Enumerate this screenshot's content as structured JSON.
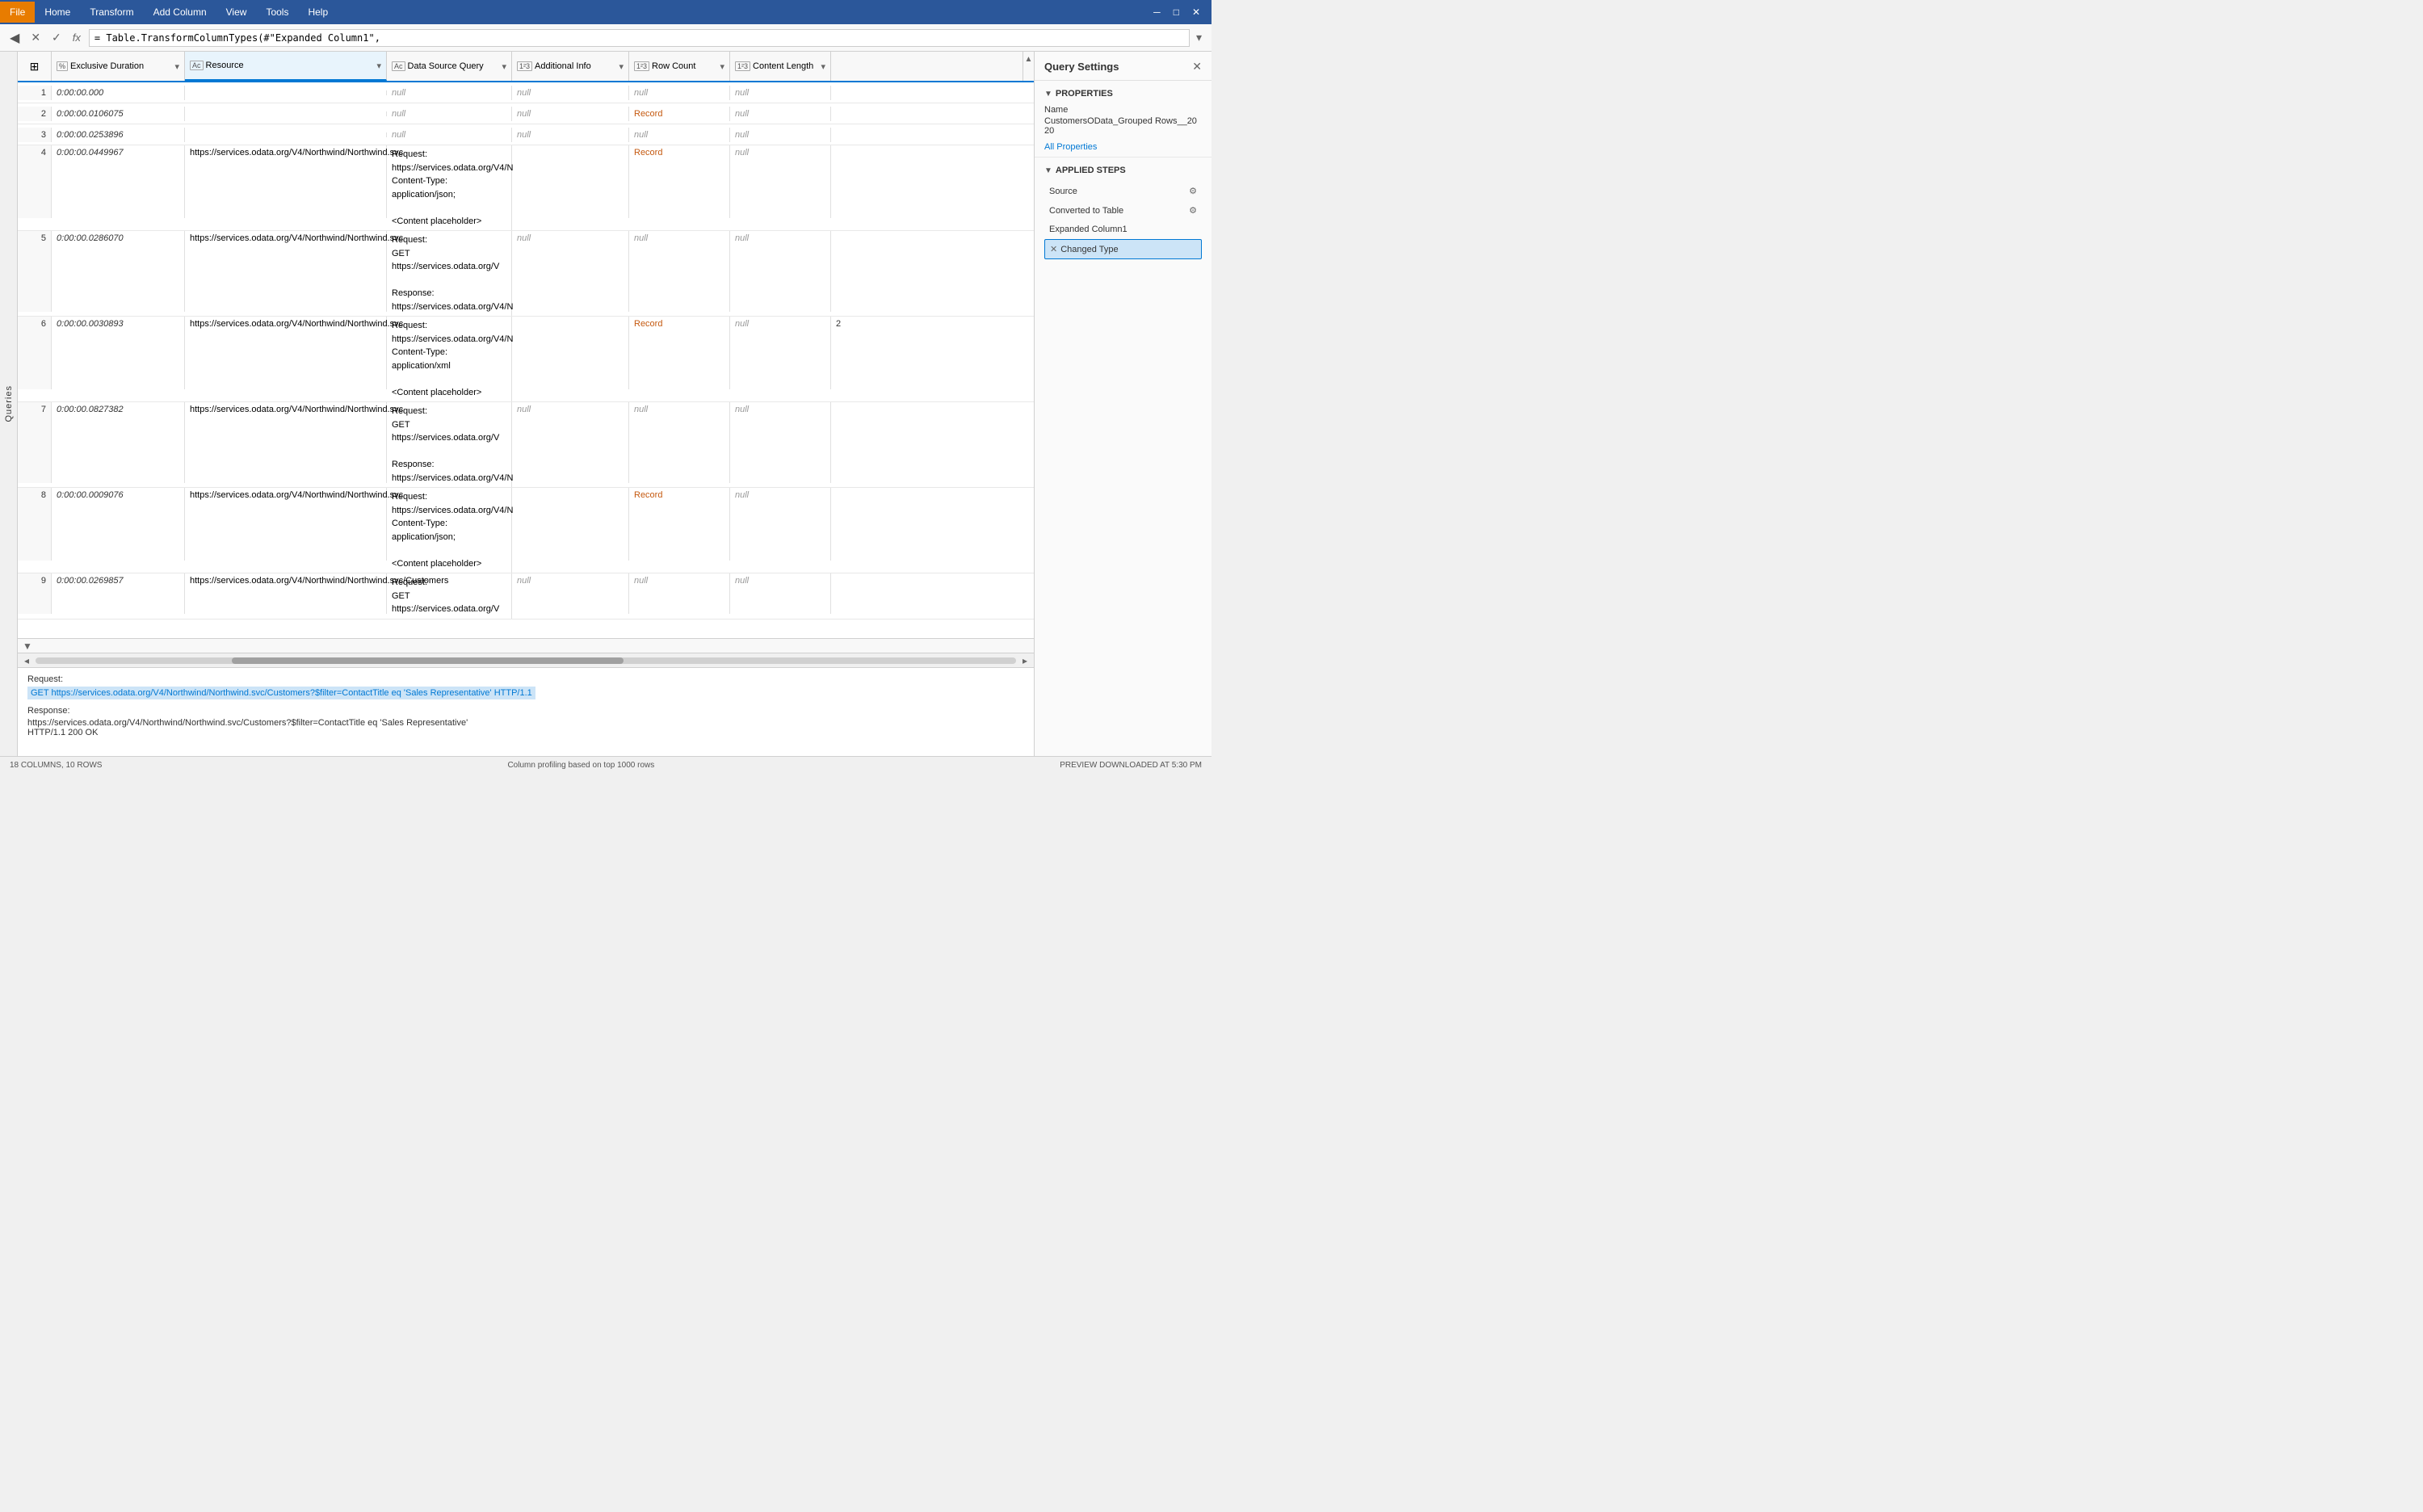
{
  "menubar": {
    "file": "File",
    "home": "Home",
    "transform": "Transform",
    "add_column": "Add Column",
    "view": "View",
    "tools": "Tools",
    "help": "Help"
  },
  "formula_bar": {
    "formula": "= Table.TransformColumnTypes(#\"Expanded Column1\","
  },
  "columns": [
    {
      "id": "row-num",
      "label": "",
      "type": "",
      "icon": ""
    },
    {
      "id": "excl-dur",
      "label": "Exclusive Duration",
      "type": "pct",
      "icon": "%"
    },
    {
      "id": "resource",
      "label": "Resource",
      "type": "text",
      "icon": "Ac"
    },
    {
      "id": "dsq",
      "label": "Data Source Query",
      "type": "text",
      "icon": "Ac"
    },
    {
      "id": "ai",
      "label": "Additional Info",
      "type": "num",
      "icon": "123"
    },
    {
      "id": "rc",
      "label": "Row Count",
      "type": "num",
      "icon": "123"
    },
    {
      "id": "cl",
      "label": "Content Length",
      "type": "num",
      "icon": "123"
    }
  ],
  "rows": [
    {
      "num": "1",
      "excl_dur": "0:00:00.000",
      "resource": "",
      "dsq": "null",
      "ai": "null",
      "rc": "null",
      "cl": "null"
    },
    {
      "num": "2",
      "excl_dur": "0:00:00.0106075",
      "resource": "",
      "dsq": "null",
      "ai": "null",
      "rc": "Record",
      "cl": "null"
    },
    {
      "num": "3",
      "excl_dur": "0:00:00.0253896",
      "resource": "",
      "dsq": "null",
      "ai": "null",
      "rc": "null",
      "cl": "null"
    },
    {
      "num": "4",
      "excl_dur": "0:00:00.0449967",
      "resource": "https://services.odata.org/V4/Northwind/Northwind.svc",
      "dsq": "Request:\nhttps://services.odata.org/V4/N\nContent-Type: application/json;\n\n<Content placeholder>",
      "ai": "",
      "rc": "Record",
      "cl": "null"
    },
    {
      "num": "5",
      "excl_dur": "0:00:00.0286070",
      "resource": "https://services.odata.org/V4/Northwind/Northwind.svc",
      "dsq": "Request:\nGET https://services.odata.org/V\n\nResponse:\nhttps://services.odata.org/V4/N",
      "ai": "null",
      "rc": "null",
      "cl": "null"
    },
    {
      "num": "6",
      "excl_dur": "0:00:00.0030893",
      "resource": "https://services.odata.org/V4/Northwind/Northwind.svc",
      "dsq": "Request:\nhttps://services.odata.org/V4/N\nContent-Type: application/xml\n\n<Content placeholder>",
      "ai": "",
      "rc": "Record",
      "cl": "null",
      "cl2": "2"
    },
    {
      "num": "7",
      "excl_dur": "0:00:00.0827382",
      "resource": "https://services.odata.org/V4/Northwind/Northwind.svc",
      "dsq": "Request:\nGET https://services.odata.org/V\n\nResponse:\nhttps://services.odata.org/V4/N",
      "ai": "null",
      "rc": "null",
      "cl": "null"
    },
    {
      "num": "8",
      "excl_dur": "0:00:00.0009076",
      "resource": "https://services.odata.org/V4/Northwind/Northwind.svc",
      "dsq": "Request:\nhttps://services.odata.org/V4/N\nContent-Type: application/json;\n\n<Content placeholder>",
      "ai": "",
      "rc": "Record",
      "cl": "null",
      "cl2": "."
    },
    {
      "num": "9",
      "excl_dur": "0:00:00.0269857",
      "resource": "https://services.odata.org/V4/Northwind/Northwind.svc/Customers",
      "dsq": "Request:\nGET https://services.odata.org/V",
      "ai": "null",
      "rc": "null",
      "cl": "null"
    }
  ],
  "preview": {
    "request_label": "Request:",
    "request_url": "GET https://services.odata.org/V4/Northwind/Northwind.svc/Customers?$filter=ContactTitle eq 'Sales Representative' HTTP/1.1",
    "response_label": "Response:",
    "response_url": "https://services.odata.org/V4/Northwind/Northwind.svc/Customers?$filter=ContactTitle eq 'Sales Representative'",
    "response_status": "HTTP/1.1 200 OK"
  },
  "right_panel": {
    "title": "Query Settings",
    "properties_section": "PROPERTIES",
    "name_label": "Name",
    "name_value": "CustomersOData_Grouped Rows__2020",
    "all_properties": "All Properties",
    "applied_steps_section": "APPLIED STEPS",
    "steps": [
      {
        "name": "Source",
        "has_gear": true,
        "has_delete": false,
        "active": false
      },
      {
        "name": "Converted to Table",
        "has_gear": true,
        "has_delete": false,
        "active": false
      },
      {
        "name": "Expanded Column1",
        "has_gear": false,
        "has_delete": false,
        "active": false
      },
      {
        "name": "Changed Type",
        "has_gear": false,
        "has_delete": true,
        "active": true
      }
    ]
  },
  "status_bar": {
    "columns_rows": "18 COLUMNS, 10 ROWS",
    "profiling": "Column profiling based on top 1000 rows",
    "preview_time": "PREVIEW DOWNLOADED AT 5:30 PM"
  },
  "icons": {
    "collapse": "▼",
    "expand": "▲",
    "chevron_down": "▾",
    "chevron_left": "◂",
    "chevron_right": "▸",
    "back": "←",
    "forward": "→",
    "checkmark": "✓",
    "cross": "✕",
    "gear": "⚙",
    "filter": "▾"
  }
}
